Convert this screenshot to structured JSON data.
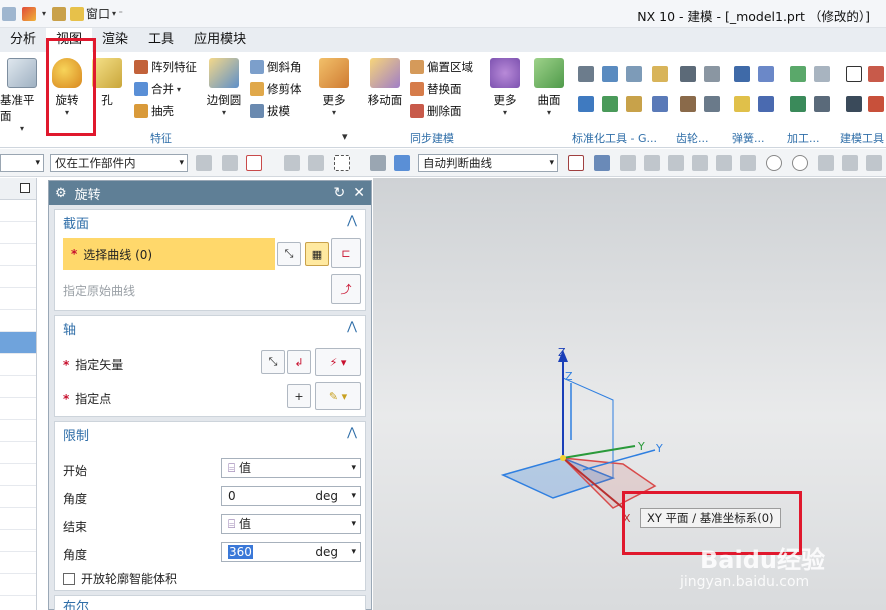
{
  "window": {
    "title": "NX 10 - 建模 - [_model1.prt （修改的）]",
    "window_menu": "窗口"
  },
  "menu_tabs": [
    "分析",
    "视图",
    "渲染",
    "工具",
    "应用模块"
  ],
  "ribbon": {
    "datum_plane": "基准平面",
    "revolve": "旋转",
    "hole": "孔",
    "pattern_feature": "阵列特征",
    "unite": "合并",
    "shell": "抽壳",
    "edge_blend": "边倒圆",
    "chamfer": "倒斜角",
    "trim_body": "修剪体",
    "draft": "拔模",
    "more1": "更多",
    "group_feature": "特征",
    "move_face": "移动面",
    "offset_region": "偏置区域",
    "replace_face": "替换面",
    "delete_face": "删除面",
    "more2": "更多",
    "group_sync": "同步建模",
    "surface": "曲面",
    "group_std": "标准化工具 - G...",
    "group_gear": "齿轮...",
    "group_spring": "弹簧...",
    "group_machining": "加工...",
    "group_build": "建模工具"
  },
  "selection_bar": {
    "scope": "仅在工作部件内",
    "curve_rule": "自动判断曲线"
  },
  "dialog": {
    "title": "旋转",
    "section": {
      "title": "截面",
      "select_curve": "选择曲线 (0)",
      "specify_origin": "指定原始曲线"
    },
    "axis": {
      "title": "轴",
      "specify_vector": "指定矢量",
      "specify_point": "指定点"
    },
    "limits": {
      "title": "限制",
      "start_label": "开始",
      "start_option": "值",
      "start_angle_label": "角度",
      "start_angle": "0",
      "end_label": "结束",
      "end_option": "值",
      "end_angle_label": "角度",
      "end_angle": "360",
      "unit": "deg",
      "open_profile": "开放轮廓智能体积"
    },
    "next_section": "布尔"
  },
  "viewport": {
    "axis_z1": "Z",
    "axis_z2": "Z",
    "axis_y1": "Y",
    "axis_y2": "Y",
    "axis_x": "X",
    "tooltip": "XY 平面 / 基准坐标系(0)"
  },
  "watermark": {
    "brand": "Baidu经验",
    "url": "jingyan.baidu.com"
  },
  "colors": {
    "accent_blue": "#2f6ea8",
    "highlight_yellow": "#ffd86b",
    "red_annotation": "#e0182d",
    "dialog_header": "#5f7f96"
  }
}
